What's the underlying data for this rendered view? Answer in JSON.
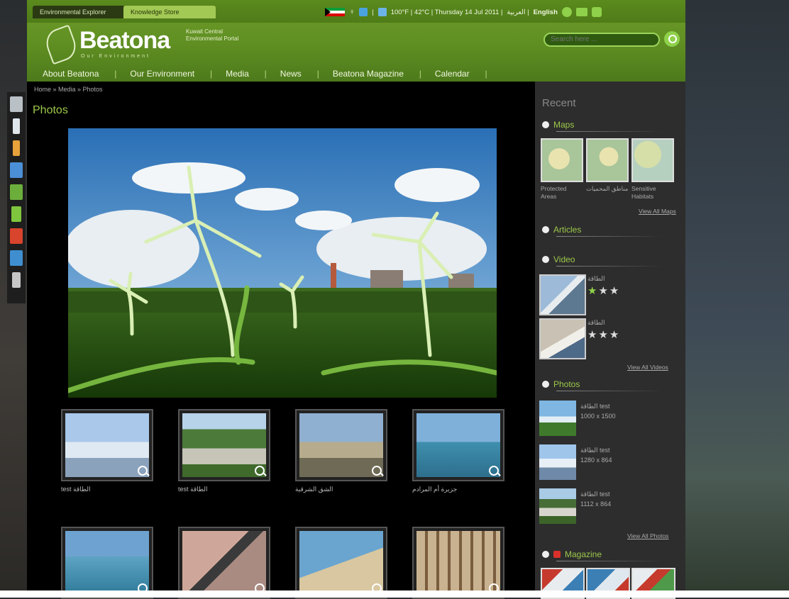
{
  "header": {
    "tabs": [
      "Environmental Explorer",
      "Knowledge Store"
    ],
    "weather": "100°F | 42°C | Thursday 14 Jul 2011 |",
    "lang_ar": "العربية |",
    "lang_en": "English",
    "brand": "Beatona",
    "brand_sub": "Our Environment",
    "brand_tag": "Kuwait Central Environmental Portal",
    "search_placeholder": "Search here ...",
    "nav": [
      "About Beatona",
      "Our Environment",
      "Media",
      "News",
      "Beatona Magazine",
      "Calendar"
    ]
  },
  "main": {
    "breadcrumb": "Home » Media » Photos",
    "title": "Photos",
    "thumb_captions": [
      "test الطاقة",
      "test الطاقة",
      "الشق الشرقية",
      "جزيرة أم المرادم"
    ]
  },
  "sidebar": {
    "recent": "Recent",
    "maps": {
      "title": "Maps",
      "captions": [
        "Protected Areas",
        "مناطق المحميات",
        "Sensitive Habitats"
      ],
      "view_all": "View All Maps"
    },
    "articles": {
      "title": "Articles"
    },
    "video": {
      "title": "Video",
      "items": [
        "الطاقة",
        "الطاقة"
      ],
      "view_all": "View All Videos"
    },
    "photos": {
      "title": "Photos",
      "items": [
        {
          "title": "الطاقة test",
          "size": "1000 x 1500"
        },
        {
          "title": "الطاقة test",
          "size": "1280 x 864"
        },
        {
          "title": "الطاقة test",
          "size": "1112 x 864"
        }
      ],
      "view_all": "View All Photos"
    },
    "magazine": {
      "title": "Magazine"
    }
  }
}
